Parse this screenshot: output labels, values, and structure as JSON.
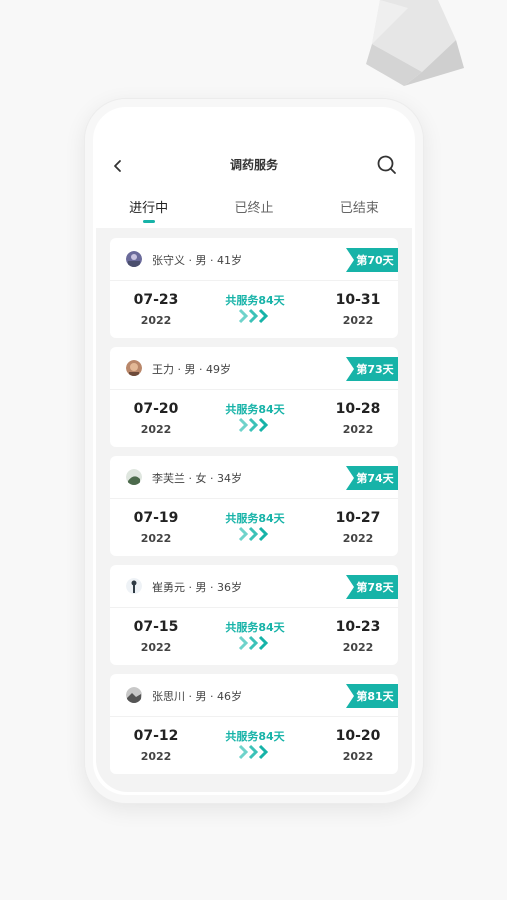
{
  "header": {
    "title": "调药服务",
    "back_icon": "chevron-left-icon",
    "search_icon": "search-icon"
  },
  "tabs": [
    {
      "label": "进行中",
      "active": true
    },
    {
      "label": "已终止",
      "active": false
    },
    {
      "label": "已结束",
      "active": false
    }
  ],
  "colors": {
    "accent": "#17b3a8",
    "list_bg": "#f3f3f3"
  },
  "cards": [
    {
      "person": "张守义 · 男 · 41岁",
      "badge": "第70天",
      "start_date": "07-23",
      "start_year": "2022",
      "service": "共服务84天",
      "end_date": "10-31",
      "end_year": "2022"
    },
    {
      "person": "王力 · 男 · 49岁",
      "badge": "第73天",
      "start_date": "07-20",
      "start_year": "2022",
      "service": "共服务84天",
      "end_date": "10-28",
      "end_year": "2022"
    },
    {
      "person": "李芙兰 · 女 · 34岁",
      "badge": "第74天",
      "start_date": "07-19",
      "start_year": "2022",
      "service": "共服务84天",
      "end_date": "10-27",
      "end_year": "2022"
    },
    {
      "person": "崔勇元 · 男 · 36岁",
      "badge": "第78天",
      "start_date": "07-15",
      "start_year": "2022",
      "service": "共服务84天",
      "end_date": "10-23",
      "end_year": "2022"
    },
    {
      "person": "张思川 · 男 · 46岁",
      "badge": "第81天",
      "start_date": "07-12",
      "start_year": "2022",
      "service": "共服务84天",
      "end_date": "10-20",
      "end_year": "2022"
    }
  ]
}
